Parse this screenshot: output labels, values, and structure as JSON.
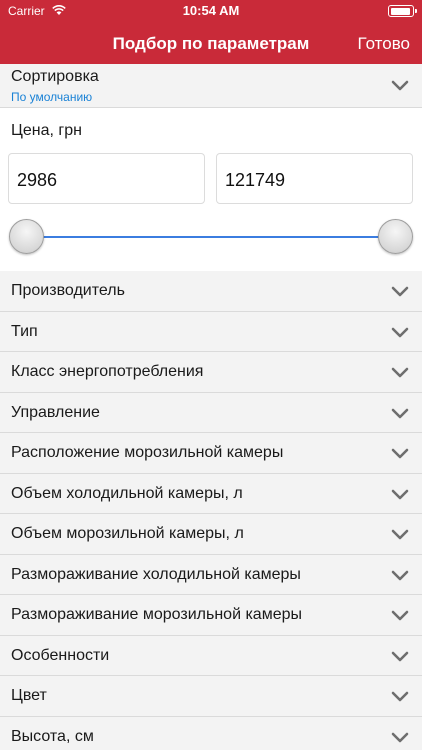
{
  "status_bar": {
    "carrier": "Carrier",
    "time": "10:54 AM"
  },
  "nav": {
    "title": "Подбор по параметрам",
    "done_label": "Готово",
    "background_color": "#c92a39"
  },
  "sort": {
    "title": "Сортировка",
    "value": "По умолчанию",
    "value_color": "#1a82d6"
  },
  "price": {
    "label": "Цена, грн",
    "min_value": "2986",
    "max_value": "121749",
    "slider_min_fraction": 0.0,
    "slider_max_fraction": 1.0,
    "track_color": "#3b7de0"
  },
  "filters": [
    {
      "label": "Производитель"
    },
    {
      "label": "Тип"
    },
    {
      "label": "Класс энергопотребления"
    },
    {
      "label": "Управление"
    },
    {
      "label": "Расположение морозильной камеры"
    },
    {
      "label": "Объем холодильной камеры, л"
    },
    {
      "label": "Объем морозильной камеры, л"
    },
    {
      "label": "Размораживание холодильной камеры"
    },
    {
      "label": "Размораживание морозильной камеры"
    },
    {
      "label": "Особенности"
    },
    {
      "label": "Цвет"
    },
    {
      "label": "Высота, см"
    }
  ],
  "icons": {
    "wifi": "wifi-icon",
    "battery": "battery-icon",
    "chevron": "chevron-down-icon"
  }
}
